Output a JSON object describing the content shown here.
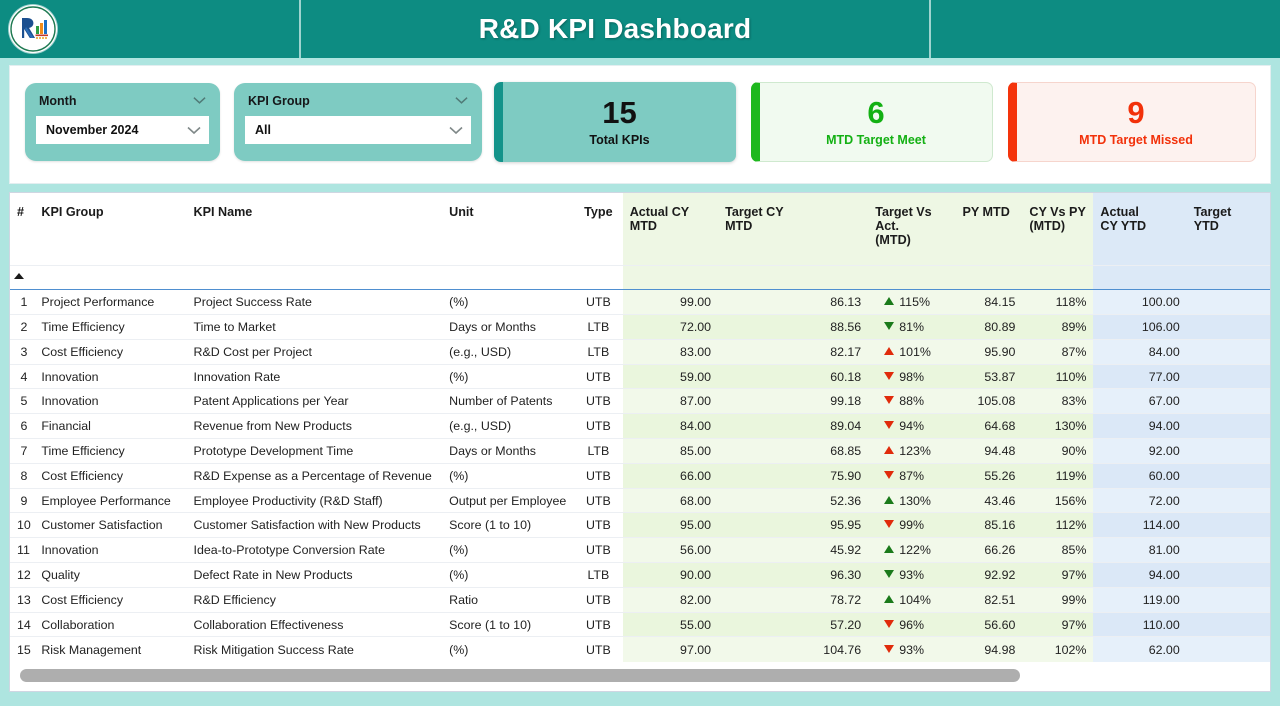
{
  "header": {
    "title": "R&D KPI Dashboard",
    "logo_icon": "rk-analytics-logo-icon"
  },
  "slicers": [
    {
      "name": "month",
      "label": "Month",
      "value": "November 2024",
      "caret_icon": "chevron-down-icon"
    },
    {
      "name": "kpi-group",
      "label": "KPI Group",
      "value": "All",
      "caret_icon": "chevron-down-icon"
    }
  ],
  "cards": [
    {
      "name": "total-kpis",
      "value": "15",
      "label": "Total KPIs",
      "color": "#111111",
      "accent": "#14938a"
    },
    {
      "name": "mtd-target-meet",
      "value": "6",
      "label": "MTD Target Meet",
      "color": "#13b013",
      "accent": "#1eb81e"
    },
    {
      "name": "mtd-target-missed",
      "value": "9",
      "label": "MTD Target Missed",
      "color": "#f2310a",
      "accent": "#f4340c"
    }
  ],
  "table": {
    "sort_indicator": "ascending",
    "columns": [
      "#",
      "KPI Group",
      "KPI Name",
      "Unit",
      "Type",
      "Actual CY MTD",
      "Target CY MTD",
      "Target Vs Act. (MTD)",
      "PY MTD",
      "CY Vs PY (MTD)",
      "Actual CY YTD",
      "Target YTD"
    ],
    "rows": [
      {
        "idx": "1",
        "group": "Project Performance",
        "kpi": "Project Success Rate",
        "unit": "(%)",
        "type": "UTB",
        "actual_cy_mtd": "99.00",
        "target_cy_mtd": "86.13",
        "tva_dir": "up",
        "tva_color": "#1a7a1a",
        "tva": "115%",
        "py_mtd": "84.15",
        "cy_vs_py": "118%",
        "actual_cy_ytd": "100.00",
        "target_ytd": ""
      },
      {
        "idx": "2",
        "group": "Time Efficiency",
        "kpi": "Time to Market",
        "unit": "Days or Months",
        "type": "LTB",
        "actual_cy_mtd": "72.00",
        "target_cy_mtd": "88.56",
        "tva_dir": "down",
        "tva_color": "#1a7a1a",
        "tva": "81%",
        "py_mtd": "80.89",
        "cy_vs_py": "89%",
        "actual_cy_ytd": "106.00",
        "target_ytd": ""
      },
      {
        "idx": "3",
        "group": "Cost Efficiency",
        "kpi": "R&D Cost per Project",
        "unit": "(e.g., USD)",
        "type": "LTB",
        "actual_cy_mtd": "83.00",
        "target_cy_mtd": "82.17",
        "tva_dir": "up",
        "tva_color": "#e02b0b",
        "tva": "101%",
        "py_mtd": "95.90",
        "cy_vs_py": "87%",
        "actual_cy_ytd": "84.00",
        "target_ytd": ""
      },
      {
        "idx": "4",
        "group": "Innovation",
        "kpi": "Innovation Rate",
        "unit": "(%)",
        "type": "UTB",
        "actual_cy_mtd": "59.00",
        "target_cy_mtd": "60.18",
        "tva_dir": "down",
        "tva_color": "#e02b0b",
        "tva": "98%",
        "py_mtd": "53.87",
        "cy_vs_py": "110%",
        "actual_cy_ytd": "77.00",
        "target_ytd": ""
      },
      {
        "idx": "5",
        "group": "Innovation",
        "kpi": "Patent Applications per Year",
        "unit": "Number of Patents",
        "type": "UTB",
        "actual_cy_mtd": "87.00",
        "target_cy_mtd": "99.18",
        "tva_dir": "down",
        "tva_color": "#e02b0b",
        "tva": "88%",
        "py_mtd": "105.08",
        "cy_vs_py": "83%",
        "actual_cy_ytd": "67.00",
        "target_ytd": ""
      },
      {
        "idx": "6",
        "group": "Financial",
        "kpi": "Revenue from New Products",
        "unit": "(e.g., USD)",
        "type": "UTB",
        "actual_cy_mtd": "84.00",
        "target_cy_mtd": "89.04",
        "tva_dir": "down",
        "tva_color": "#e02b0b",
        "tva": "94%",
        "py_mtd": "64.68",
        "cy_vs_py": "130%",
        "actual_cy_ytd": "94.00",
        "target_ytd": ""
      },
      {
        "idx": "7",
        "group": "Time Efficiency",
        "kpi": "Prototype Development Time",
        "unit": "Days or Months",
        "type": "LTB",
        "actual_cy_mtd": "85.00",
        "target_cy_mtd": "68.85",
        "tva_dir": "up",
        "tva_color": "#e02b0b",
        "tva": "123%",
        "py_mtd": "94.48",
        "cy_vs_py": "90%",
        "actual_cy_ytd": "92.00",
        "target_ytd": ""
      },
      {
        "idx": "8",
        "group": "Cost Efficiency",
        "kpi": "R&D Expense as a Percentage of Revenue",
        "unit": "(%)",
        "type": "UTB",
        "actual_cy_mtd": "66.00",
        "target_cy_mtd": "75.90",
        "tva_dir": "down",
        "tva_color": "#e02b0b",
        "tva": "87%",
        "py_mtd": "55.26",
        "cy_vs_py": "119%",
        "actual_cy_ytd": "60.00",
        "target_ytd": ""
      },
      {
        "idx": "9",
        "group": "Employee Performance",
        "kpi": "Employee Productivity (R&D Staff)",
        "unit": "Output per Employee",
        "type": "UTB",
        "actual_cy_mtd": "68.00",
        "target_cy_mtd": "52.36",
        "tva_dir": "up",
        "tva_color": "#1a7a1a",
        "tva": "130%",
        "py_mtd": "43.46",
        "cy_vs_py": "156%",
        "actual_cy_ytd": "72.00",
        "target_ytd": ""
      },
      {
        "idx": "10",
        "group": "Customer Satisfaction",
        "kpi": "Customer Satisfaction with New Products",
        "unit": "Score (1 to 10)",
        "type": "UTB",
        "actual_cy_mtd": "95.00",
        "target_cy_mtd": "95.95",
        "tva_dir": "down",
        "tva_color": "#e02b0b",
        "tva": "99%",
        "py_mtd": "85.16",
        "cy_vs_py": "112%",
        "actual_cy_ytd": "114.00",
        "target_ytd": ""
      },
      {
        "idx": "11",
        "group": "Innovation",
        "kpi": "Idea-to-Prototype Conversion Rate",
        "unit": "(%)",
        "type": "UTB",
        "actual_cy_mtd": "56.00",
        "target_cy_mtd": "45.92",
        "tva_dir": "up",
        "tva_color": "#1a7a1a",
        "tva": "122%",
        "py_mtd": "66.26",
        "cy_vs_py": "85%",
        "actual_cy_ytd": "81.00",
        "target_ytd": ""
      },
      {
        "idx": "12",
        "group": "Quality",
        "kpi": "Defect Rate in New Products",
        "unit": "(%)",
        "type": "LTB",
        "actual_cy_mtd": "90.00",
        "target_cy_mtd": "96.30",
        "tva_dir": "down",
        "tva_color": "#1a7a1a",
        "tva": "93%",
        "py_mtd": "92.92",
        "cy_vs_py": "97%",
        "actual_cy_ytd": "94.00",
        "target_ytd": ""
      },
      {
        "idx": "13",
        "group": "Cost Efficiency",
        "kpi": "R&D Efficiency",
        "unit": "Ratio",
        "type": "UTB",
        "actual_cy_mtd": "82.00",
        "target_cy_mtd": "78.72",
        "tva_dir": "up",
        "tva_color": "#1a7a1a",
        "tva": "104%",
        "py_mtd": "82.51",
        "cy_vs_py": "99%",
        "actual_cy_ytd": "119.00",
        "target_ytd": ""
      },
      {
        "idx": "14",
        "group": "Collaboration",
        "kpi": "Collaboration Effectiveness",
        "unit": "Score (1 to 10)",
        "type": "UTB",
        "actual_cy_mtd": "55.00",
        "target_cy_mtd": "57.20",
        "tva_dir": "down",
        "tva_color": "#e02b0b",
        "tva": "96%",
        "py_mtd": "56.60",
        "cy_vs_py": "97%",
        "actual_cy_ytd": "110.00",
        "target_ytd": ""
      },
      {
        "idx": "15",
        "group": "Risk Management",
        "kpi": "Risk Mitigation Success Rate",
        "unit": "(%)",
        "type": "UTB",
        "actual_cy_mtd": "97.00",
        "target_cy_mtd": "104.76",
        "tva_dir": "down",
        "tva_color": "#e02b0b",
        "tva": "93%",
        "py_mtd": "94.98",
        "cy_vs_py": "102%",
        "actual_cy_ytd": "62.00",
        "target_ytd": ""
      }
    ]
  },
  "scrollbar": {
    "name": "horizontal-scrollbar"
  }
}
